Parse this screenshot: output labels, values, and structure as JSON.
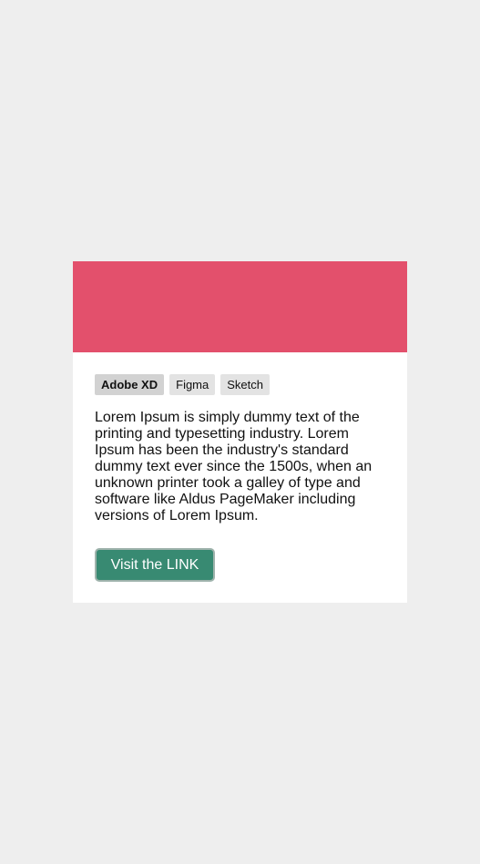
{
  "card": {
    "banner_color": "#e3506c",
    "tags": [
      {
        "label": "Adobe XD",
        "active": true
      },
      {
        "label": "Figma",
        "active": false
      },
      {
        "label": "Sketch",
        "active": false
      }
    ],
    "description": "Lorem Ipsum is simply dummy text of the printing and typesetting industry. Lorem Ipsum has been the industry's standard dummy text ever since the 1500s, when an unknown printer took a galley of type and software like Aldus PageMaker including versions of Lorem Ipsum.",
    "button_label": "Visit the LINK",
    "button_color": "#388a72"
  }
}
